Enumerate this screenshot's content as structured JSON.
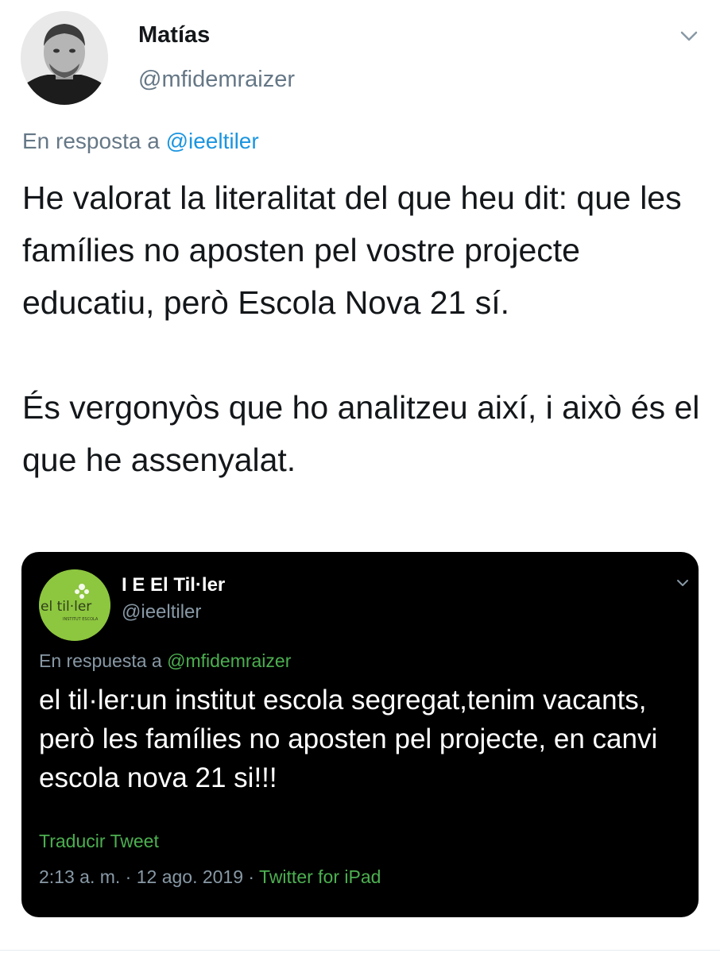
{
  "author": {
    "name": "Matías",
    "handle": "@mfidemraizer"
  },
  "reply": {
    "prefix": "En resposta a",
    "mention": "@ieeltiler"
  },
  "tweet": {
    "paragraph1": "He valorat la literalitat del que heu dit: que les famílies no aposten pel vostre projecte educatiu, però Escola Nova 21 sí.",
    "paragraph2": "És vergonyòs que ho analitzeu així, i això és el que he assenyalat."
  },
  "embedded": {
    "name": "I E El Til·ler",
    "handle": "@ieeltiler",
    "avatar_text": "el til·ler",
    "avatar_subtext": "INSTITUT ESCOLA",
    "reply_prefix": "En respuesta a",
    "reply_mention": "@mfidemraizer",
    "text": "el til·ler:un institut escola segregat,tenim vacants, però les famílies no aposten pel projecte, en canvi escola nova 21 si!!!",
    "translate_label": "Traducir Tweet",
    "timestamp": "2:13 a. m. · 12 ago. 2019 ·",
    "source": "Twitter for iPad"
  },
  "icons": {
    "more_options": "chevron-down-icon",
    "embedded_more_options": "chevron-down-icon",
    "avatar": "user-photo",
    "embedded_avatar": "school-logo"
  },
  "colors": {
    "link_blue": "#1b95e0",
    "secondary_gray": "#657786",
    "embed_background": "#000000",
    "embed_accent_green": "#4caf50",
    "logo_green": "#8dc63f"
  }
}
